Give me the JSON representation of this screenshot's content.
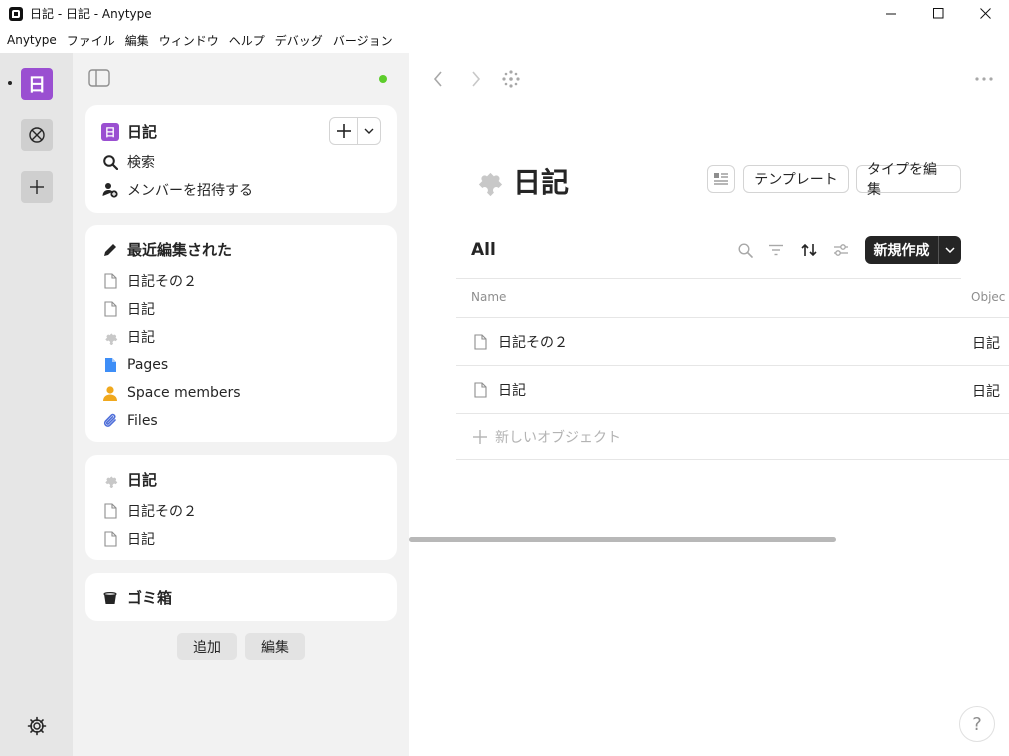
{
  "window": {
    "title": "日記 - 日記 - Anytype",
    "minimize_icon": "minimize-icon",
    "maximize_icon": "maximize-icon",
    "close_icon": "close-icon"
  },
  "menu": [
    "Anytype",
    "ファイル",
    "編集",
    "ウィンドウ",
    "ヘルプ",
    "デバッグ",
    "バージョン"
  ],
  "rail": {
    "space_avatar_letter": "日",
    "space_avatar_color": "#9a4fd1"
  },
  "sidebar": {
    "space_widget": {
      "title": "日記",
      "avatar_letter": "日",
      "items": [
        {
          "label": "検索",
          "icon": "search-icon"
        },
        {
          "label": "メンバーを招待する",
          "icon": "invite-member-icon"
        }
      ]
    },
    "recent_widget": {
      "title": "最近編集された",
      "items": [
        {
          "label": "日記その２",
          "icon": "page-icon"
        },
        {
          "label": "日記",
          "icon": "page-icon"
        },
        {
          "label": "日記",
          "icon": "type-icon"
        },
        {
          "label": "Pages",
          "icon": "pages-icon"
        },
        {
          "label": "Space members",
          "icon": "members-icon"
        },
        {
          "label": "Files",
          "icon": "paperclip-icon"
        }
      ]
    },
    "type_widget": {
      "title": "日記",
      "items": [
        {
          "label": "日記その２",
          "icon": "page-icon"
        },
        {
          "label": "日記",
          "icon": "page-icon"
        }
      ]
    },
    "bin_widget": {
      "title": "ゴミ箱"
    },
    "add_button": "追加",
    "edit_button": "編集"
  },
  "main": {
    "title": "日記",
    "template_button": "テンプレート",
    "edit_type_button": "タイプを編集",
    "view_name": "All",
    "new_button": "新規作成",
    "columns": [
      "Name",
      "Objec"
    ],
    "rows": [
      {
        "name": "日記その２",
        "type": "日記"
      },
      {
        "name": "日記",
        "type": "日記"
      }
    ],
    "add_object_label": "新しいオブジェクト",
    "help_label": "?"
  },
  "colors": {
    "accent_purple": "#9a4fd1",
    "sync_green": "#5dcd2c",
    "pages_blue": "#3e8ef7",
    "members_orange": "#f0a81d",
    "files_blue": "#4f6fd9"
  }
}
